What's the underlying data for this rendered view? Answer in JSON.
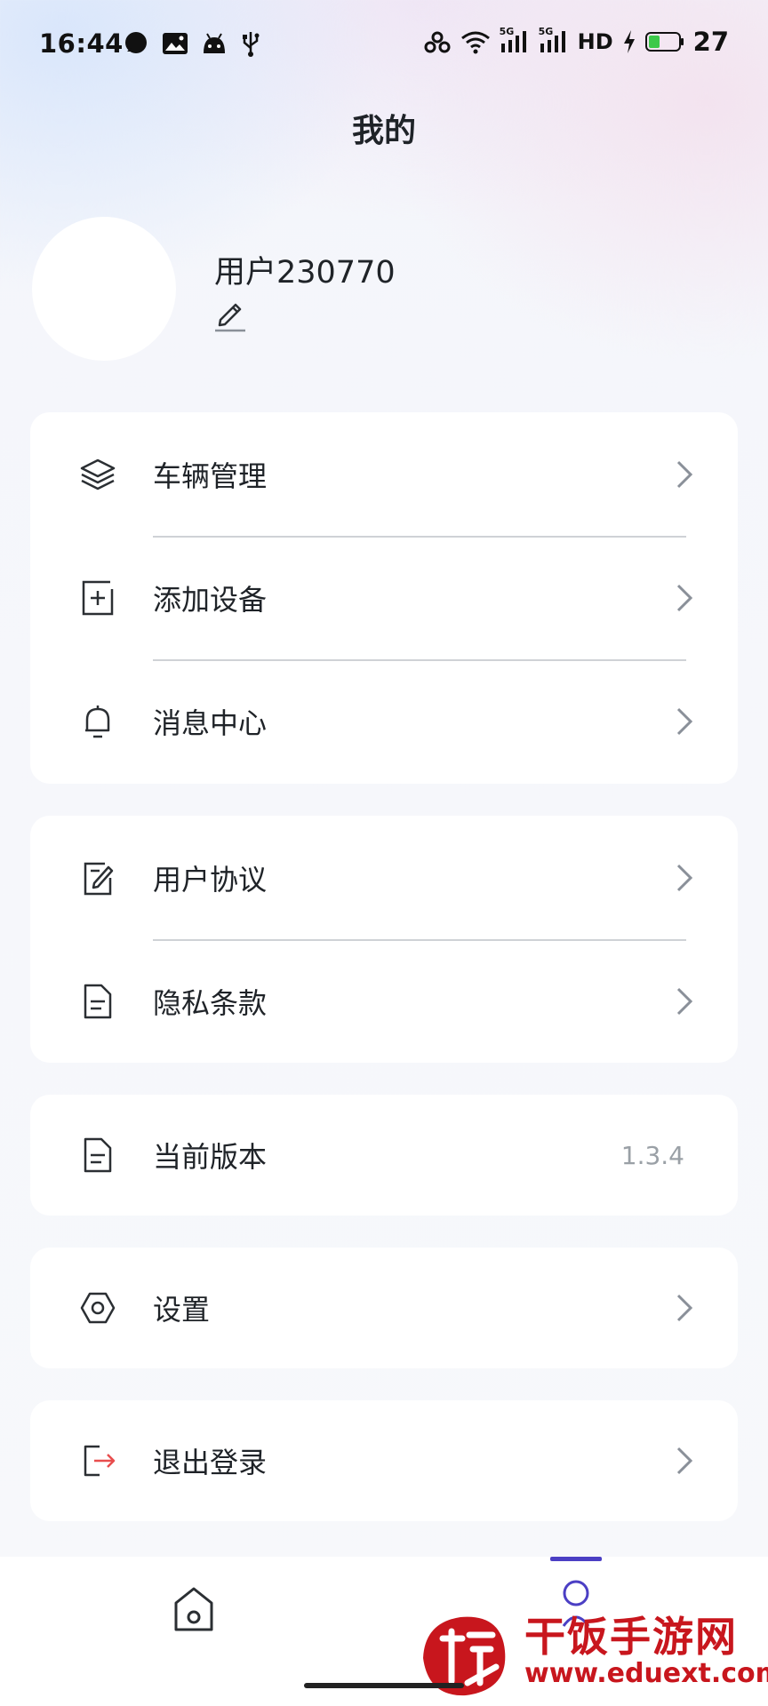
{
  "status_bar": {
    "time": "16:44",
    "signal_1_label": "5G",
    "signal_2_label": "5G",
    "hd_label": "HD",
    "battery_level": "27",
    "icons": [
      "message-bubble-icon",
      "image-notification-icon",
      "android-icon",
      "usb-icon",
      "link-icon",
      "wifi-icon",
      "signal-5g-icon",
      "signal-5g-icon",
      "hd-voice-icon",
      "charging-icon",
      "battery-icon"
    ]
  },
  "header": {
    "title": "我的"
  },
  "profile": {
    "username": "用户230770",
    "edit_icon": "pencil-icon"
  },
  "menu_groups": [
    {
      "items": [
        {
          "label": "车辆管理",
          "icon": "layers-icon"
        },
        {
          "label": "添加设备",
          "icon": "add-square-icon"
        },
        {
          "label": "消息中心",
          "icon": "bell-icon"
        }
      ]
    },
    {
      "items": [
        {
          "label": "用户协议",
          "icon": "agreement-icon"
        },
        {
          "label": "隐私条款",
          "icon": "document-icon"
        }
      ]
    },
    {
      "items": [
        {
          "label": "当前版本",
          "icon": "document-icon",
          "value": "1.3.4"
        }
      ]
    },
    {
      "items": [
        {
          "label": "设置",
          "icon": "hexagon-gear-icon"
        }
      ]
    },
    {
      "items": [
        {
          "label": "退出登录",
          "icon": "logout-icon"
        }
      ]
    }
  ],
  "tab_bar": {
    "tabs": [
      {
        "name": "home",
        "icon": "home-icon",
        "active": false
      },
      {
        "name": "mine",
        "icon": "profile-icon",
        "active": true
      }
    ],
    "accent_color": "#4b3fc4"
  },
  "watermark": {
    "name": "干饭手游网",
    "url": "www.eduext.com",
    "color": "#c8161d"
  }
}
